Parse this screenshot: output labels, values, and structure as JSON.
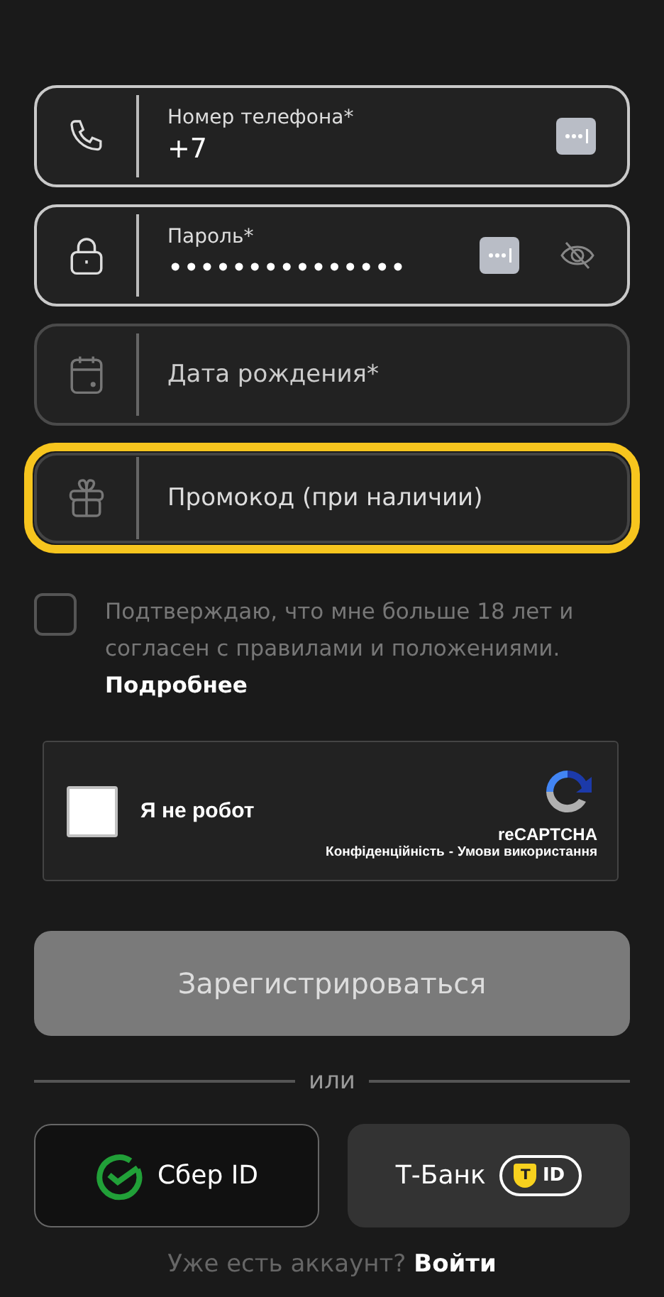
{
  "fields": [
    {
      "kind": "phone",
      "label": "Номер телефона*",
      "value": "+7",
      "autofill": true,
      "reveal": false,
      "focused": false,
      "dimmed": false
    },
    {
      "kind": "password",
      "label": "Пароль*",
      "value": "•••••••••••••••",
      "autofill": true,
      "reveal": true,
      "focused": false,
      "dimmed": false
    },
    {
      "kind": "date",
      "placeholder": "Дата рождения*",
      "focused": false,
      "dimmed": true
    },
    {
      "kind": "promo",
      "placeholder": "Промокод (при наличии)",
      "focused": true,
      "dimmed": false
    }
  ],
  "consent": {
    "checked": false,
    "text": "Подтверждаю, что мне больше 18 лет и согласен с правилами и положениями.",
    "link": "Подробнее"
  },
  "captcha": {
    "checked": false,
    "label": "Я не робот",
    "brand": "reCAPTCHA",
    "privacy": "Конфіденційність",
    "separator": "-",
    "terms": "Умови використання"
  },
  "submit": {
    "label": "Зарегистрироваться",
    "disabled": true
  },
  "divider": "или",
  "social": [
    {
      "kind": "sber",
      "label": "Сбер ID"
    },
    {
      "kind": "tbank",
      "label": "Т-Банк",
      "badge_mark": "T",
      "badge_text": "ID"
    }
  ],
  "footer": {
    "text": "Уже есть аккаунт?",
    "link": "Войти"
  }
}
